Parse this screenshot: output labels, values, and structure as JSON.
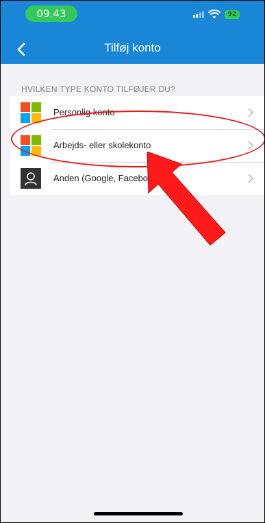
{
  "status_bar": {
    "time": "09.43",
    "battery": "92",
    "icons": [
      "signal-icon",
      "wifi-icon",
      "battery-icon"
    ]
  },
  "nav": {
    "title": "Tilføj konto",
    "back_icon": "chevron-left-icon"
  },
  "section": {
    "header": "HVILKEN TYPE KONTO TILFØJER DU?"
  },
  "accounts": [
    {
      "label": "Personlig konto",
      "icon": "microsoft-logo-icon"
    },
    {
      "label": "Arbejds- eller skolekonto",
      "icon": "microsoft-logo-icon"
    },
    {
      "label": "Anden (Google, Facebook o",
      "icon": "person-icon"
    }
  ],
  "colors": {
    "header": "#1a86d8",
    "status_pill": "#34c759",
    "annotation": "#e51c1c",
    "background": "#f2f2f7",
    "ms_red": "#f25022",
    "ms_green": "#7fba00",
    "ms_blue": "#00a4ef",
    "ms_yellow": "#ffb900"
  }
}
